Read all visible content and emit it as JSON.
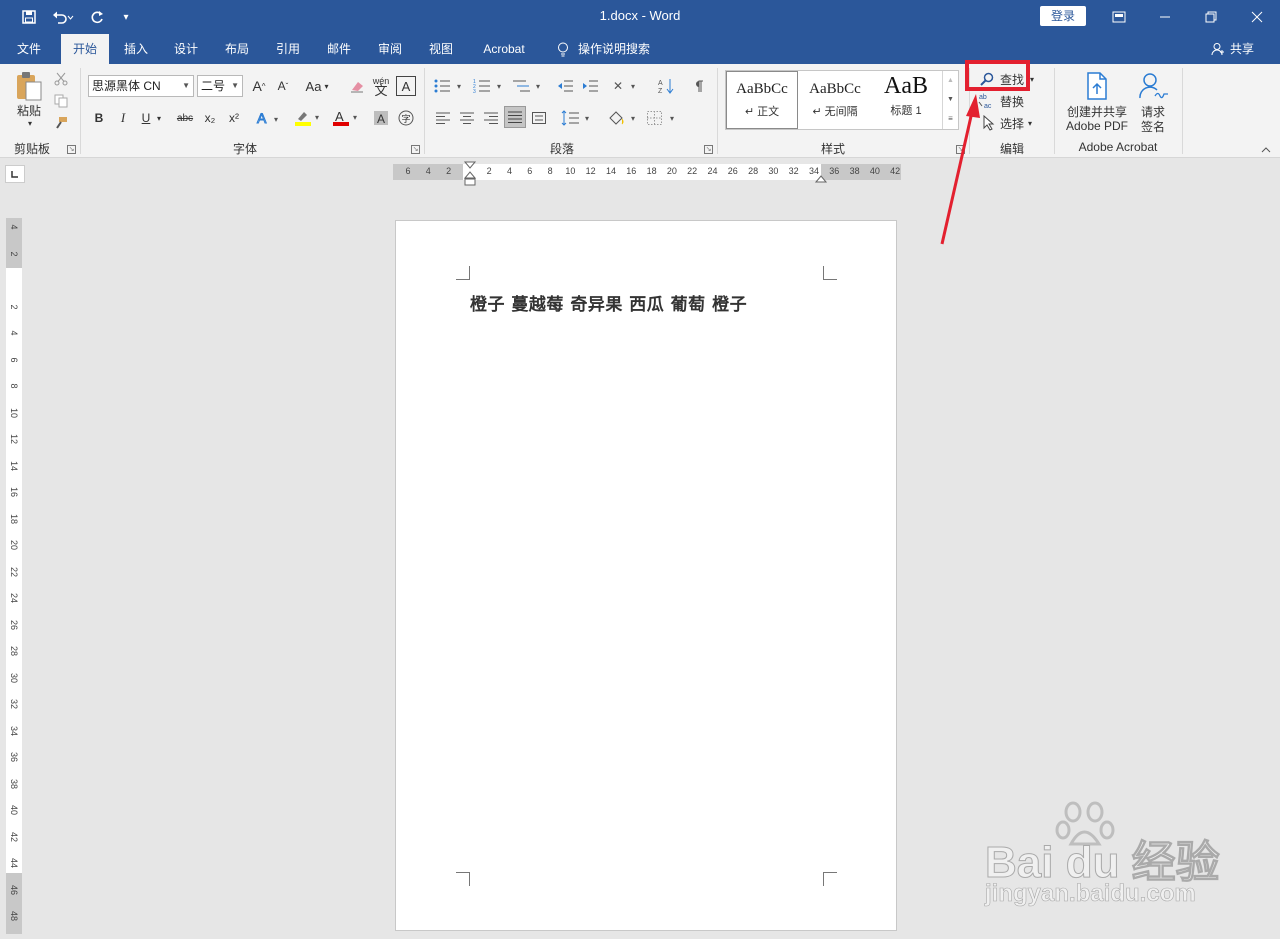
{
  "titlebar": {
    "title": "1.docx  -  Word",
    "login_label": "登录",
    "save_icon": "save-icon",
    "undo_icon": "undo-icon",
    "redo_icon": "redo-icon"
  },
  "tabs": [
    {
      "label": "文件"
    },
    {
      "label": "开始",
      "active": true
    },
    {
      "label": "插入"
    },
    {
      "label": "设计"
    },
    {
      "label": "布局"
    },
    {
      "label": "引用"
    },
    {
      "label": "邮件"
    },
    {
      "label": "审阅"
    },
    {
      "label": "视图"
    },
    {
      "label": "Acrobat"
    },
    {
      "label": "操作说明搜索"
    }
  ],
  "share_label": "共享",
  "ribbon": {
    "clipboard": {
      "paste_label": "粘贴",
      "group_label": "剪贴板"
    },
    "font": {
      "font_name": "思源黑体 CN",
      "font_size": "二号",
      "group_label": "字体",
      "bold": "B",
      "italic": "I",
      "underline": "U",
      "strike": "abc",
      "subscript": "x₂",
      "superscript": "x²",
      "grow": "A",
      "shrink": "A",
      "case": "Aa",
      "phonetic": "wén",
      "border_char": "A"
    },
    "paragraph": {
      "group_label": "段落"
    },
    "styles": {
      "group_label": "样式",
      "items": [
        {
          "preview": "AaBbCc",
          "label": "正文"
        },
        {
          "preview": "AaBbCc",
          "label": "无间隔"
        },
        {
          "preview": "AaB",
          "label": "标题 1"
        }
      ]
    },
    "editing": {
      "find": "查找",
      "replace": "替换",
      "select": "选择",
      "group_label": "编辑"
    },
    "acrobat": {
      "create_pdf_line1": "创建并共享",
      "create_pdf_line2": "Adobe PDF",
      "sign_line1": "请求",
      "sign_line2": "签名",
      "group_label": "Adobe Acrobat"
    }
  },
  "ruler": {
    "h_ticks": [
      "6",
      "4",
      "2",
      "",
      "2",
      "4",
      "6",
      "8",
      "10",
      "12",
      "14",
      "16",
      "18",
      "20",
      "22",
      "24",
      "26",
      "28",
      "30",
      "32",
      "34",
      "36",
      "38",
      "40",
      "42"
    ],
    "v_ticks": [
      "4",
      "2",
      "",
      "2",
      "4",
      "6",
      "8",
      "10",
      "12",
      "14",
      "16",
      "18",
      "20",
      "22",
      "24",
      "26",
      "28",
      "30",
      "32",
      "34",
      "36",
      "38",
      "40",
      "42",
      "44",
      "46",
      "48"
    ]
  },
  "document": {
    "text": "橙子  蔓越莓  奇异果  西瓜  葡萄  橙子"
  },
  "watermark": {
    "brand": "Bai du 经验",
    "url": "jingyan.baidu.com"
  },
  "colors": {
    "titlebar": "#2b579a",
    "highlight": "#e3202f"
  }
}
